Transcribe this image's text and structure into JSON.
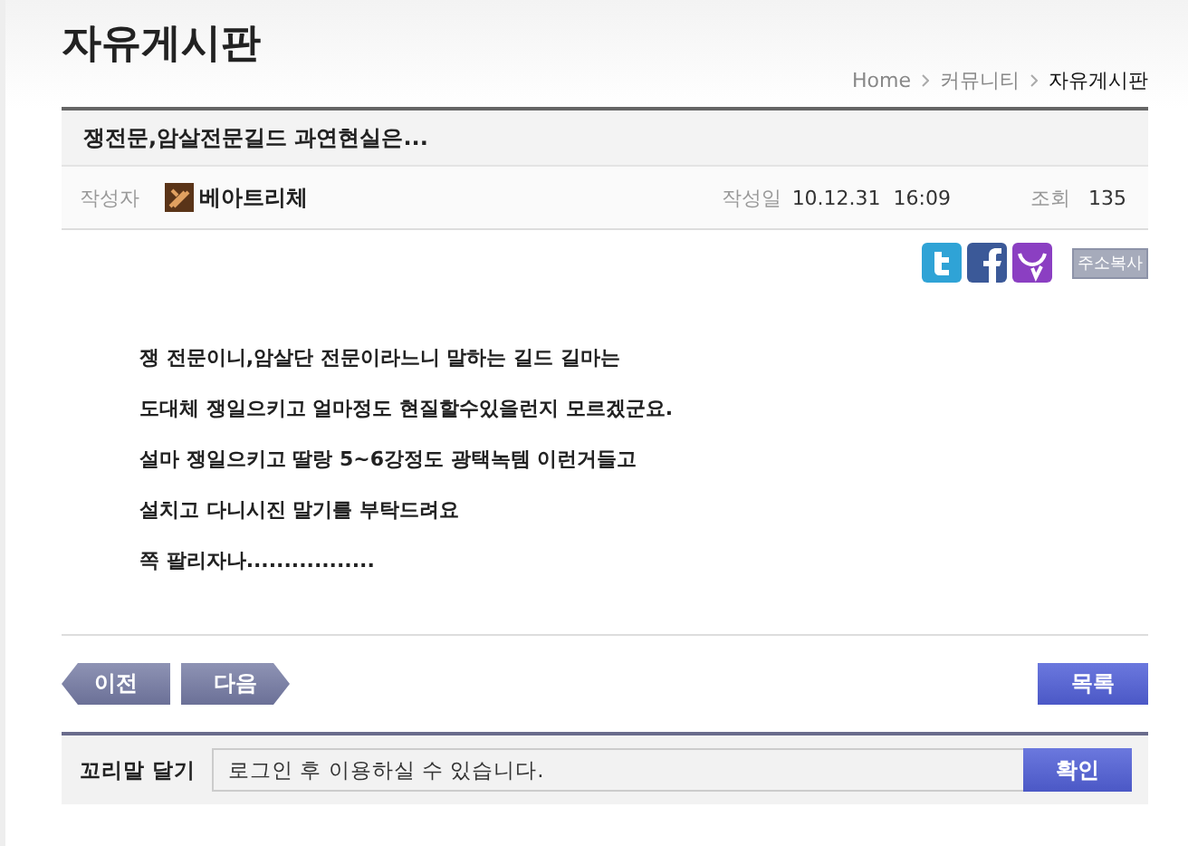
{
  "page_title": "자유게시판",
  "breadcrumb": [
    {
      "label": "Home",
      "current": false
    },
    {
      "label": "커뮤니티",
      "current": false
    },
    {
      "label": "자유게시판",
      "current": true
    }
  ],
  "post": {
    "title": "쟁전문,암살전문길드 과연현실은...",
    "author_label": "작성자",
    "author": "베아트리체",
    "date_label": "작성일",
    "date": "10.12.31  16:09",
    "views_label": "조회",
    "views": "135"
  },
  "share": {
    "copy_button": "주소복사"
  },
  "body": [
    "쟁 전문이니,암살단 전문이라느니 말하는 길드 길마는",
    "도대체 쟁일으키고 얼마정도 현질할수있을런지 모르겠군요.",
    "설마 쟁일으키고 딸랑 5~6강정도 광택녹템 이런거들고",
    "설치고 다니시진 말기를 부탁드려요",
    "쪽 팔리자나................."
  ],
  "nav": {
    "prev": "이전",
    "next": "다음",
    "list": "목록"
  },
  "comment": {
    "label": "꼬리말 달기",
    "value": "로그인 후 이용하실 수 있습니다.",
    "submit": "확인"
  }
}
